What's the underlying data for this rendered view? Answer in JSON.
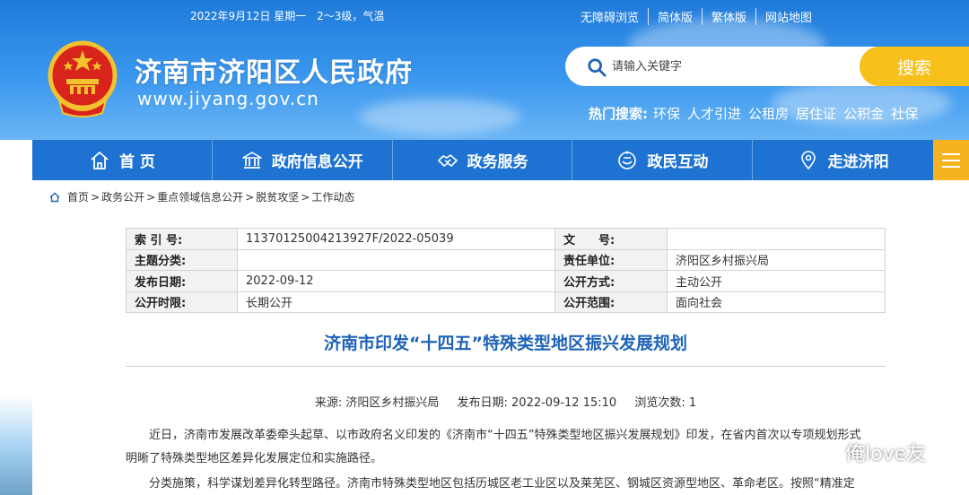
{
  "topbar": {
    "date": "2022年9月12日 星期一",
    "weather": "2～3级，气温",
    "links": [
      "无障碍浏览",
      "简体版",
      "繁体版",
      "网站地图"
    ]
  },
  "site": {
    "title": "济南市济阳区人民政府",
    "url": "www.jiyang.gov.cn"
  },
  "search": {
    "placeholder": "请输入关键字",
    "button": "搜索"
  },
  "hot": {
    "label": "热门搜索:",
    "items": [
      "环保",
      "人才引进",
      "公租房",
      "居住证",
      "公积金",
      "社保"
    ]
  },
  "nav": {
    "items": [
      {
        "label": "首 页",
        "icon": "home-icon"
      },
      {
        "label": "政府信息公开",
        "icon": "government-building-icon"
      },
      {
        "label": "政务服务",
        "icon": "handshake-icon"
      },
      {
        "label": "政民互动",
        "icon": "interaction-icon"
      },
      {
        "label": "走进济阳",
        "icon": "location-pin-icon"
      }
    ],
    "menu_icon": "menu-icon"
  },
  "breadcrumb": [
    "首页",
    "政务公开",
    "重点领域信息公开",
    "脱贫攻坚",
    "工作动态"
  ],
  "info": {
    "rows": [
      {
        "k1": "索 引 号:",
        "v1": "11370125004213927F/2022-05039",
        "k2": "文　　号:",
        "v2": ""
      },
      {
        "k1": "主题分类:",
        "v1": "",
        "k2": "责任单位:",
        "v2": "济阳区乡村振兴局"
      },
      {
        "k1": "发布日期:",
        "v1": "2022-09-12",
        "k2": "公开方式:",
        "v2": "主动公开"
      },
      {
        "k1": "公开时限:",
        "v1": "长期公开",
        "k2": "公开范围:",
        "v2": "面向社会"
      }
    ]
  },
  "article": {
    "title": "济南市印发“十四五”特殊类型地区振兴发展规划",
    "source": "来源: 济阳区乡村振兴局",
    "date": "发布日期: 2022-09-12 15:10",
    "views": "浏览次数: 1",
    "p1_line1": "近日，济南市发展改革委牵头起草、以市政府名义印发的《济南市“十四五”特殊类型地区振兴发展规划》印发，在省内首次以专项规划形式",
    "p1_line2": "明晰了特殊类型地区差异化发展定位和实施路径。",
    "p2_line1": "分类施策，科学谋划差异化转型路径。济南市特殊类型地区包括历城区老工业区以及莱芜区、钢城区资源型地区、革命老区。按照“精准定"
  },
  "watermark": {
    "text": "俺love友"
  },
  "colors": {
    "header_blue": "#1f7ad9",
    "nav_blue": "#1e73d2",
    "accent_yellow": "#f8c01b",
    "title_blue": "#1e63b8"
  }
}
